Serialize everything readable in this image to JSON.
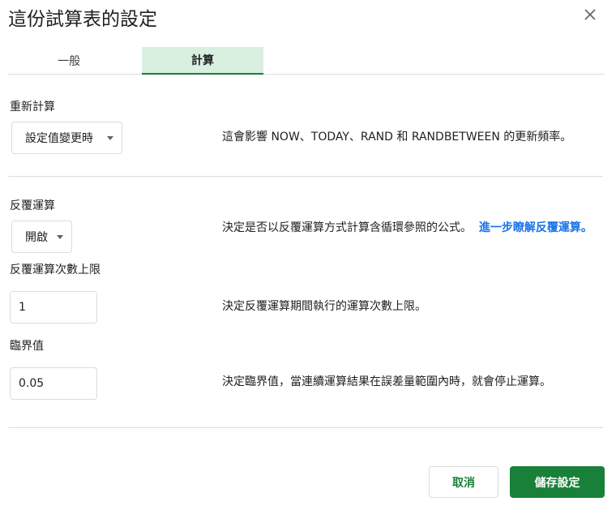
{
  "dialog": {
    "title": "這份試算表的設定",
    "close_icon": "close-icon"
  },
  "tabs": [
    {
      "label": "一般",
      "selected": false
    },
    {
      "label": "計算",
      "selected": true
    }
  ],
  "recalculation": {
    "label": "重新計算",
    "value": "設定值變更時",
    "description": "這會影響 NOW、TODAY、RAND 和 RANDBETWEEN 的更新頻率。"
  },
  "iterative": {
    "label": "反覆運算",
    "value": "開啟",
    "description": "決定是否以反覆運算方式計算含循環參照的公式。",
    "link_text": "進一步瞭解反覆運算。"
  },
  "max_iterations": {
    "label": "反覆運算次數上限",
    "value": "1",
    "description": "決定反覆運算期間執行的運算次數上限。"
  },
  "threshold": {
    "label": "臨界值",
    "value": "0.05",
    "description": "決定臨界值，當連續運算結果在誤差量範圍內時，就會停止運算。"
  },
  "footer": {
    "cancel_label": "取消",
    "save_label": "儲存設定"
  },
  "colors": {
    "accent": "#188038",
    "selected_tab_bg": "#d9f0e1",
    "link": "#1a73e8"
  }
}
